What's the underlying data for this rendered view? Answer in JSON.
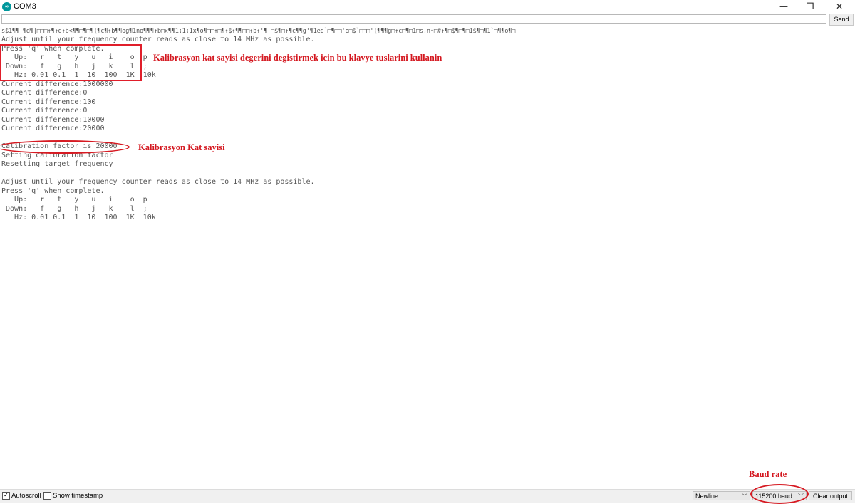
{
  "window": {
    "title": "COM3",
    "minimize": "—",
    "restore": "❐",
    "close": "✕"
  },
  "input": {
    "value": "",
    "send_label": "Send"
  },
  "output": {
    "garbage": "s$1¶¶|¶d¶|□□□↑¶↑d↑b<¶¶□¶□¶{¶c¶↑b¶¶og¶1no¶¶¶↑b□x¶¶1;1;1x¶o¶□□↑□¶↑$↑¶¶□□↑b↑'¶|□$¶□↑¶c¶¶g'¶1ëd`□¶□□'o□$`□□□'{¶¶¶g□↑c□¶□1□s,n↑□#↑¶□$¶□¶□1$¶□¶1`□¶¶o¶□",
    "lines": [
      "Adjust until your frequency counter reads as close to 14 MHz as possible.",
      "Press 'q' when complete.",
      "   Up:   r   t   y   u   i    o  p",
      " Down:   f   g   h   j   k    l  ;",
      "   Hz: 0.01 0.1  1  10  100  1K  10k",
      "Current difference:1000000",
      "Current difference:0",
      "Current difference:100",
      "Current difference:0",
      "Current difference:10000",
      "Current difference:20000",
      "",
      "Calibration factor is 20000",
      "Setting calibration factor",
      "Resetting target frequency",
      "",
      "Adjust until your frequency counter reads as close to 14 MHz as possible.",
      "Press 'q' when complete.",
      "   Up:   r   t   y   u   i    o  p",
      " Down:   f   g   h   j   k    l  ;",
      "   Hz: 0.01 0.1  1  10  100  1K  10k"
    ]
  },
  "annotations": {
    "keys_note": "Kalibrasyon kat sayisi degerini degistirmek icin bu klavye tuslarini kullanin",
    "factor_note": "Kalibrasyon Kat sayisi",
    "baud_note": "Baud rate",
    "color": "#d4171f"
  },
  "statusbar": {
    "autoscroll_label": "Autoscroll",
    "autoscroll_checked": true,
    "timestamp_label": "Show timestamp",
    "timestamp_checked": false,
    "line_ending": "Newline",
    "baud": "115200 baud",
    "clear_label": "Clear output"
  },
  "colors": {
    "logo": "#00979c",
    "text": "#555555"
  }
}
